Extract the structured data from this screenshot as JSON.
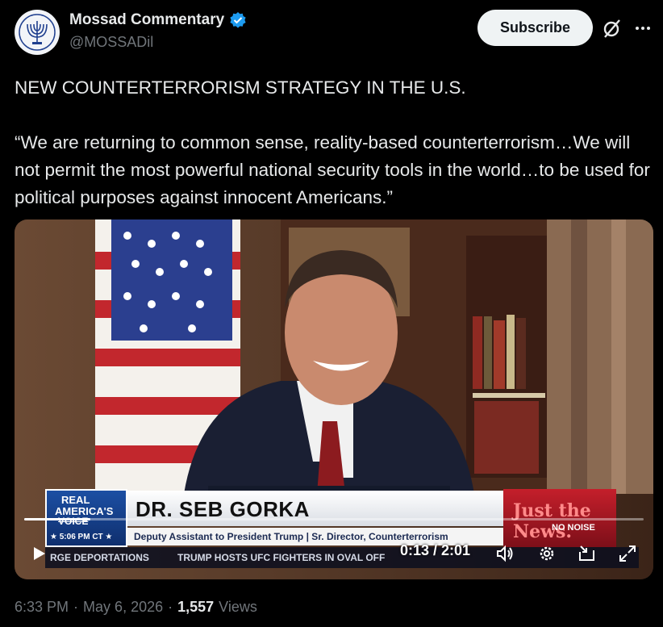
{
  "author": {
    "display_name": "Mossad Commentary",
    "handle": "@MOSSADil",
    "avatar_icon": "menorah-seal-icon",
    "verified_color": "#1d9bf0"
  },
  "actions": {
    "subscribe_label": "Subscribe",
    "grok_icon": "grok-slash-icon",
    "more_icon": "more-dots-icon"
  },
  "tweet": {
    "line1": "NEW COUNTERTERRORISM STRATEGY IN THE U.S.",
    "quote": "“We are returning to common sense, reality-based counterterrorism…We will not permit the most powerful national security tools in the world…to be used for political purposes against innocent Americans.”"
  },
  "video": {
    "chyron_brand_line1": "REAL",
    "chyron_brand_line2": "AMERICA'S",
    "chyron_brand_line3": "VOICE",
    "chyron_time": "★ 5:06 PM CT ★",
    "chyron_name": "DR. SEB GORKA",
    "chyron_title": "Deputy Assistant to President Trump | Sr. Director, Counterterrorism",
    "news_logo_line1": "Just the News.",
    "news_logo_line2": "NO NOISE",
    "ticker_left": "RGE DEPORTATIONS",
    "ticker_right": "TRUMP HOSTS UFC FIGHTERS IN OVAL OFF",
    "time_display": "0:13 / 2:01",
    "progress_fraction": 0.107,
    "controls": [
      "play-icon",
      "volume-icon",
      "settings-gear-icon",
      "minimize-icon",
      "fullscreen-icon"
    ]
  },
  "footer": {
    "time": "6:33 PM",
    "date": "May 6, 2026",
    "separator": "·",
    "views_count": "1,557",
    "views_label": "Views"
  }
}
